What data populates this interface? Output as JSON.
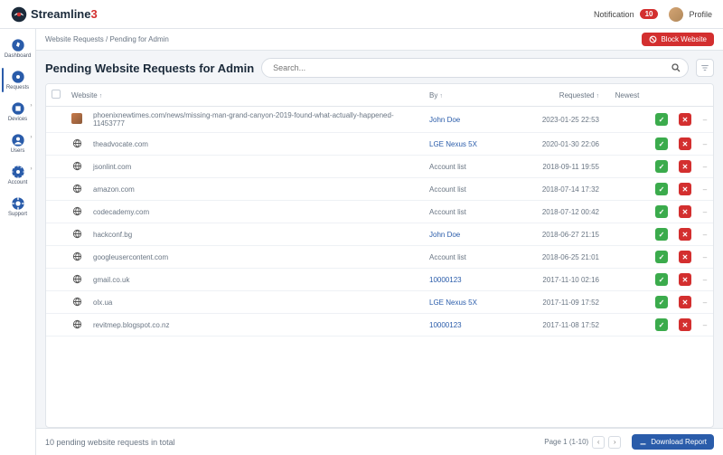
{
  "brand": {
    "name": "Streamline",
    "suffix": "3"
  },
  "header": {
    "notification_label": "Notification",
    "notification_count": "10",
    "profile_label": "Profile"
  },
  "sidebar": {
    "items": [
      {
        "label": "Dashboard",
        "icon": "compass",
        "active": false
      },
      {
        "label": "Requests",
        "icon": "target",
        "active": true
      },
      {
        "label": "Devices",
        "icon": "devices",
        "active": false,
        "chev": true
      },
      {
        "label": "Users",
        "icon": "users",
        "active": false,
        "chev": true
      },
      {
        "label": "Account",
        "icon": "account",
        "active": false,
        "chev": true
      },
      {
        "label": "Support",
        "icon": "support",
        "active": false
      }
    ]
  },
  "breadcrumb": {
    "root": "Website Requests",
    "sep": " / ",
    "leaf": "Pending for Admin"
  },
  "actions": {
    "block_website": "Block Website",
    "download_report": "Download Report"
  },
  "page_title": "Pending Website Requests for Admin",
  "search": {
    "placeholder": "Search..."
  },
  "columns": {
    "website": "Website",
    "by": "By",
    "requested": "Requested",
    "newest": "Newest"
  },
  "rows": [
    {
      "icon": "image",
      "site": "phoenixnewtimes.com/news/missing-man-grand-canyon-2019-found-what-actually-happened-11453777",
      "by": "John Doe",
      "by_link": true,
      "requested": "2023-01-25 22:53"
    },
    {
      "icon": "globe",
      "site": "theadvocate.com",
      "by": "LGE Nexus 5X",
      "by_link": true,
      "requested": "2020-01-30 22:06"
    },
    {
      "icon": "globe",
      "site": "jsonlint.com",
      "by": "Account list",
      "by_link": false,
      "requested": "2018-09-11 19:55"
    },
    {
      "icon": "globe",
      "site": "amazon.com",
      "by": "Account list",
      "by_link": false,
      "requested": "2018-07-14 17:32"
    },
    {
      "icon": "globe",
      "site": "codecademy.com",
      "by": "Account list",
      "by_link": false,
      "requested": "2018-07-12 00:42"
    },
    {
      "icon": "globe",
      "site": "hackconf.bg",
      "by": "John Doe",
      "by_link": true,
      "requested": "2018-06-27 21:15"
    },
    {
      "icon": "globe",
      "site": "googleusercontent.com",
      "by": "Account list",
      "by_link": false,
      "requested": "2018-06-25 21:01"
    },
    {
      "icon": "globe",
      "site": "gmail.co.uk",
      "by": "10000123",
      "by_link": true,
      "requested": "2017-11-10 02:16"
    },
    {
      "icon": "globe",
      "site": "olx.ua",
      "by": "LGE Nexus 5X",
      "by_link": true,
      "requested": "2017-11-09 17:52"
    },
    {
      "icon": "globe",
      "site": "revitmep.blogspot.co.nz",
      "by": "10000123",
      "by_link": true,
      "requested": "2017-11-08 17:52"
    }
  ],
  "footer": {
    "status": "10 pending website requests in total",
    "page_label": "Page 1 (1-10)"
  }
}
